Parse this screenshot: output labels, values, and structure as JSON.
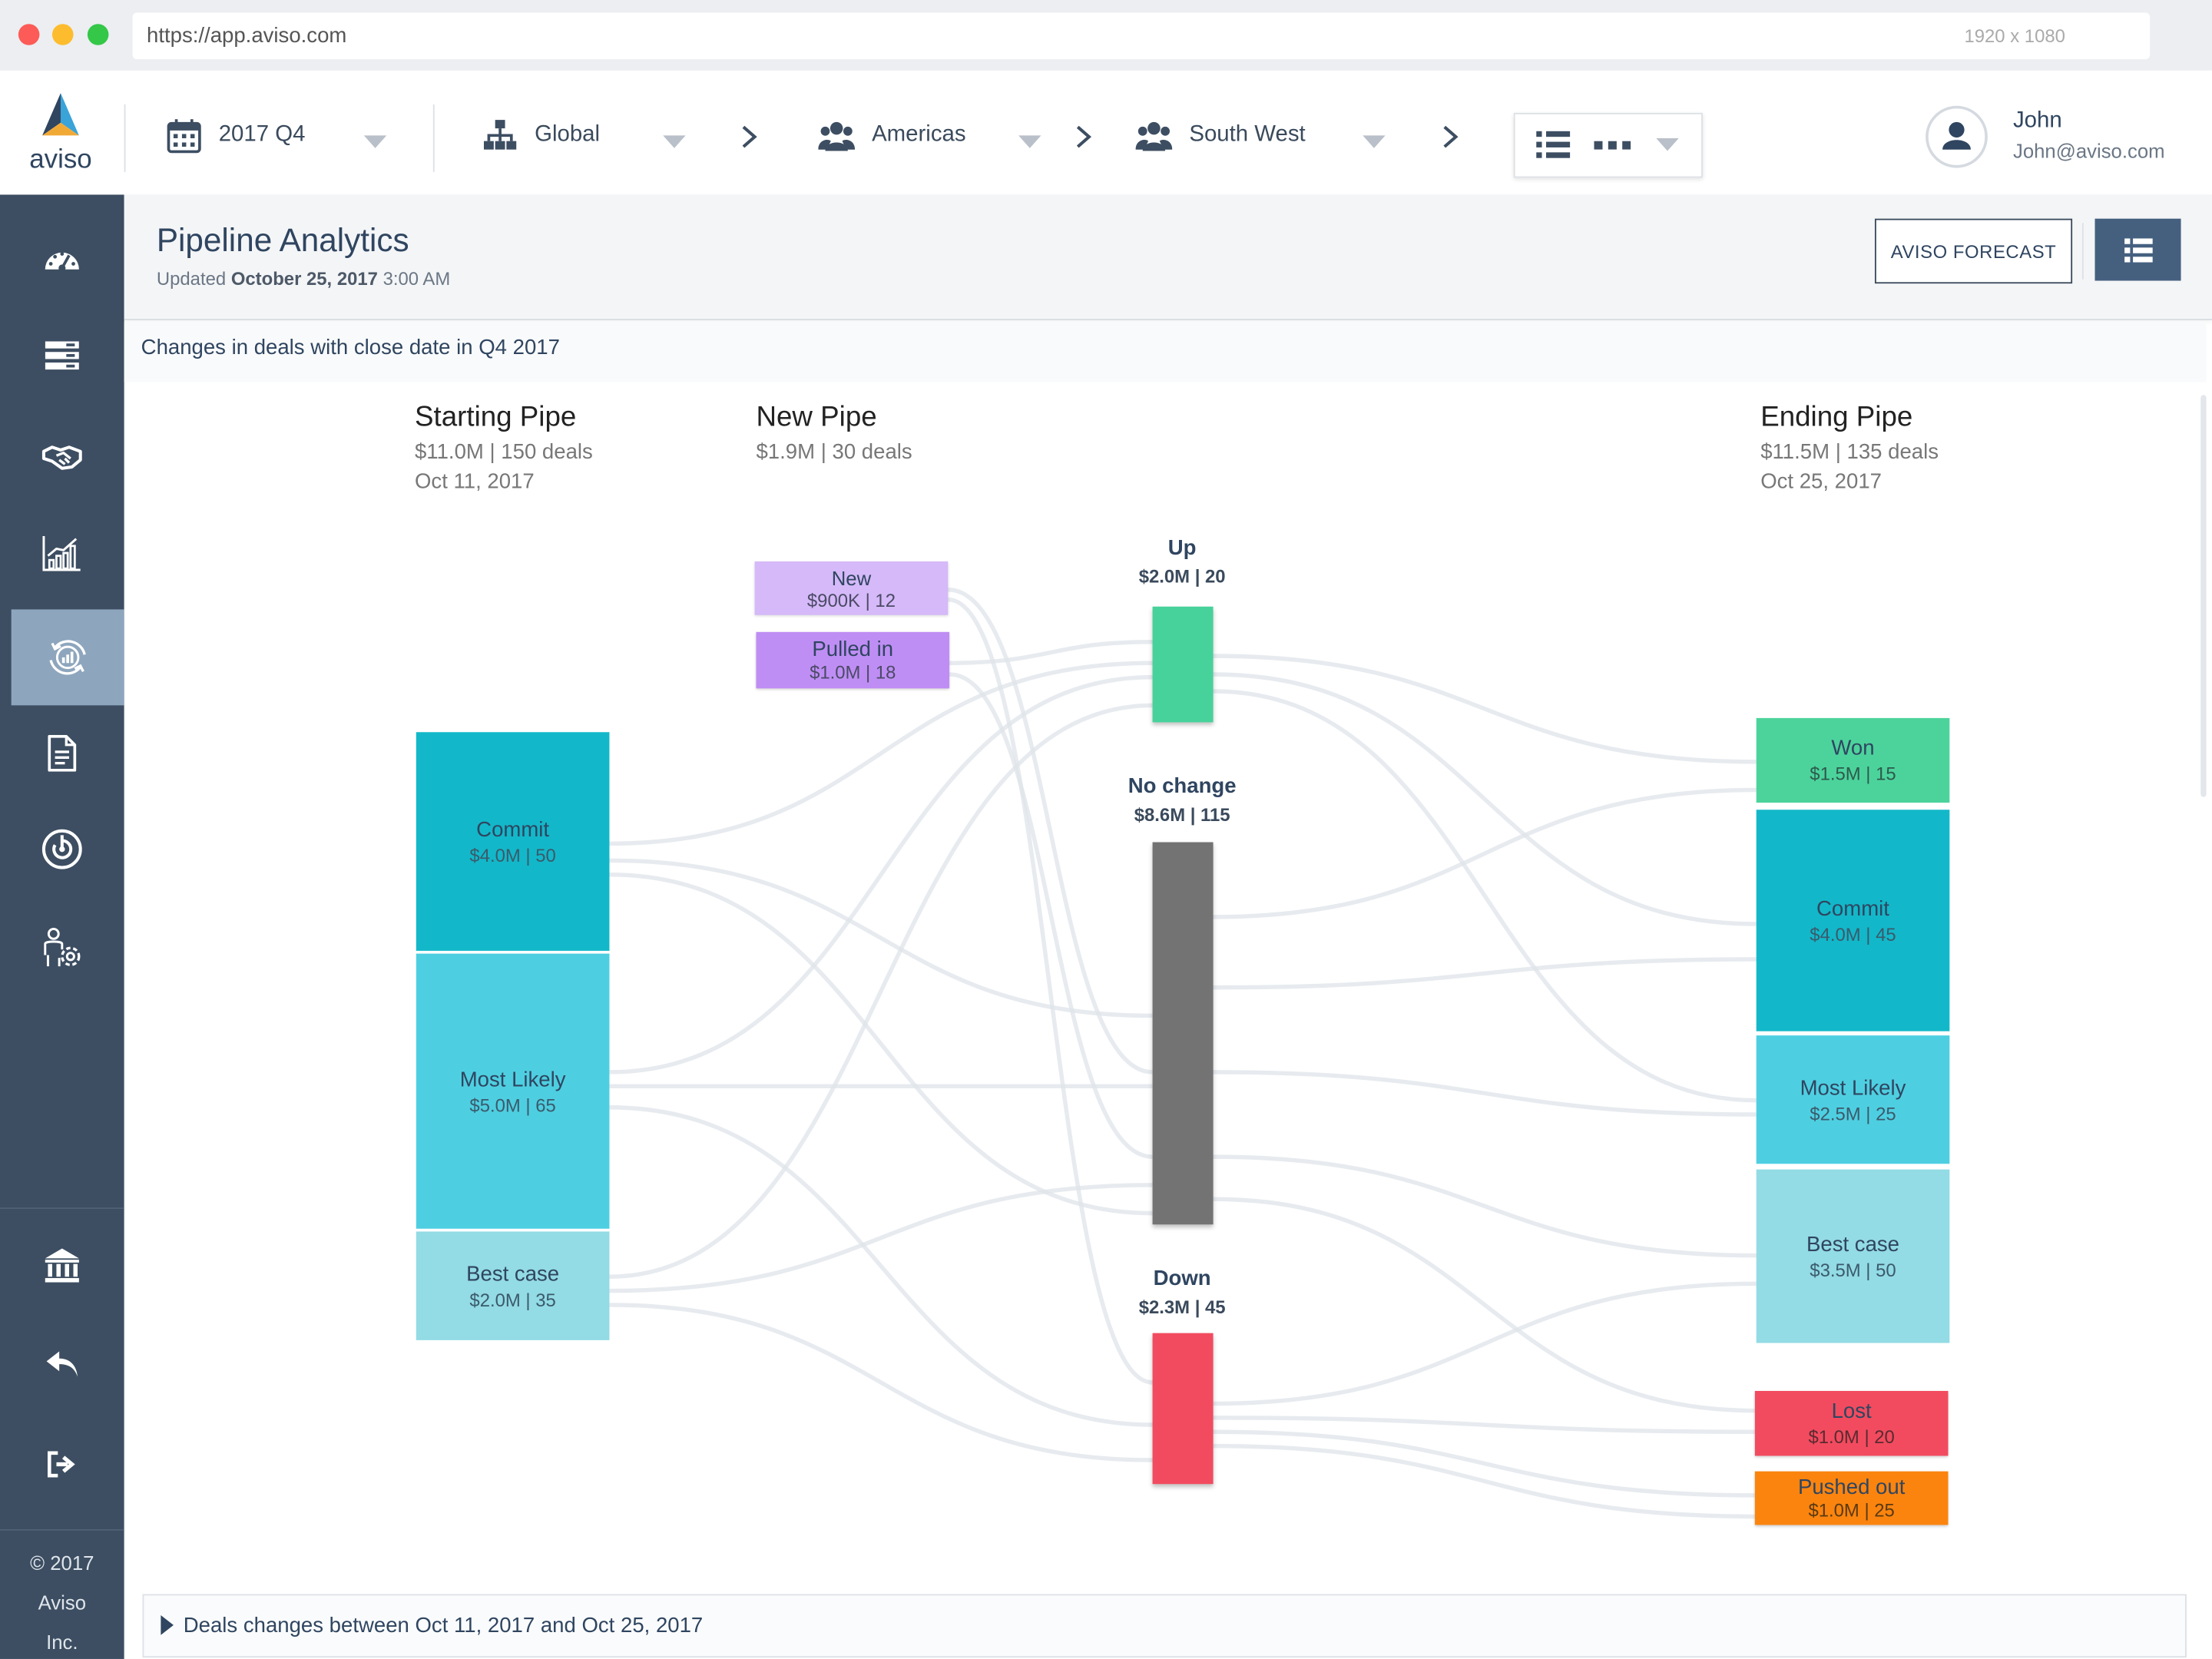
{
  "browser": {
    "url": "https://app.aviso.com",
    "resolution": "1920 x 1080"
  },
  "logo": {
    "text": "aviso"
  },
  "nav": {
    "period": "2017 Q4",
    "hierarchy": [
      "Global",
      "Americas",
      "South West"
    ]
  },
  "user": {
    "name": "John",
    "email": "John@aviso.com"
  },
  "sidebar": {
    "icons": [
      "dashboard-icon",
      "pipeline-icon",
      "deals-icon",
      "trends-icon",
      "pipeline-analytics-icon",
      "reports-icon",
      "target-icon",
      "admin-icon"
    ],
    "bottom_icons": [
      "bank-icon",
      "reply-icon",
      "logout-icon"
    ],
    "copyright": [
      "© 2017",
      "Aviso",
      "Inc."
    ]
  },
  "page": {
    "title": "Pipeline Analytics",
    "updated_prefix": "Updated",
    "updated_date": "October 25, 2017",
    "updated_time": "3:00 AM",
    "forecast_button": "AVISO FORECAST",
    "subtitle": "Changes in deals with close date in Q4 2017",
    "footer": "Deals changes between Oct 11, 2017 and Oct 25, 2017"
  },
  "columns": {
    "starting": {
      "title": "Starting Pipe",
      "summary": "$11.0M | 150 deals",
      "date": "Oct 11, 2017"
    },
    "new": {
      "title": "New Pipe",
      "summary": "$1.9M | 30 deals"
    },
    "ending": {
      "title": "Ending Pipe",
      "summary": "$11.5M | 135 deals",
      "date": "Oct 25, 2017"
    }
  },
  "colors": {
    "commit": "#12b8c9",
    "most_likely": "#4ecfe1",
    "best_case": "#93dbe5",
    "won": "#4cd39c",
    "lost": "#f24b5f",
    "pushed_out": "#fb840f",
    "new": "#d5b9f8",
    "pulled_in": "#bf8ef4",
    "up": "#47d29b",
    "no_change": "#737373",
    "down": "#f24b5f",
    "sidebar": "#3d4e62",
    "accent": "#45607f"
  },
  "starting_nodes": [
    {
      "label": "Commit",
      "value": "$4.0M | 50"
    },
    {
      "label": "Most Likely",
      "value": "$5.0M | 65"
    },
    {
      "label": "Best case",
      "value": "$2.0M | 35"
    }
  ],
  "new_nodes": [
    {
      "label": "New",
      "value": "$900K | 12"
    },
    {
      "label": "Pulled in",
      "value": "$1.0M | 18"
    }
  ],
  "change_nodes": [
    {
      "label": "Up",
      "value": "$2.0M | 20"
    },
    {
      "label": "No change",
      "value": "$8.6M | 115"
    },
    {
      "label": "Down",
      "value": "$2.3M | 45"
    }
  ],
  "ending_nodes": [
    {
      "label": "Won",
      "value": "$1.5M | 15"
    },
    {
      "label": "Commit",
      "value": "$4.0M | 45"
    },
    {
      "label": "Most Likely",
      "value": "$2.5M | 25"
    },
    {
      "label": "Best case",
      "value": "$3.5M | 50"
    },
    {
      "label": "Lost",
      "value": "$1.0M | 20"
    },
    {
      "label": "Pushed out",
      "value": "$1.0M | 25"
    }
  ]
}
